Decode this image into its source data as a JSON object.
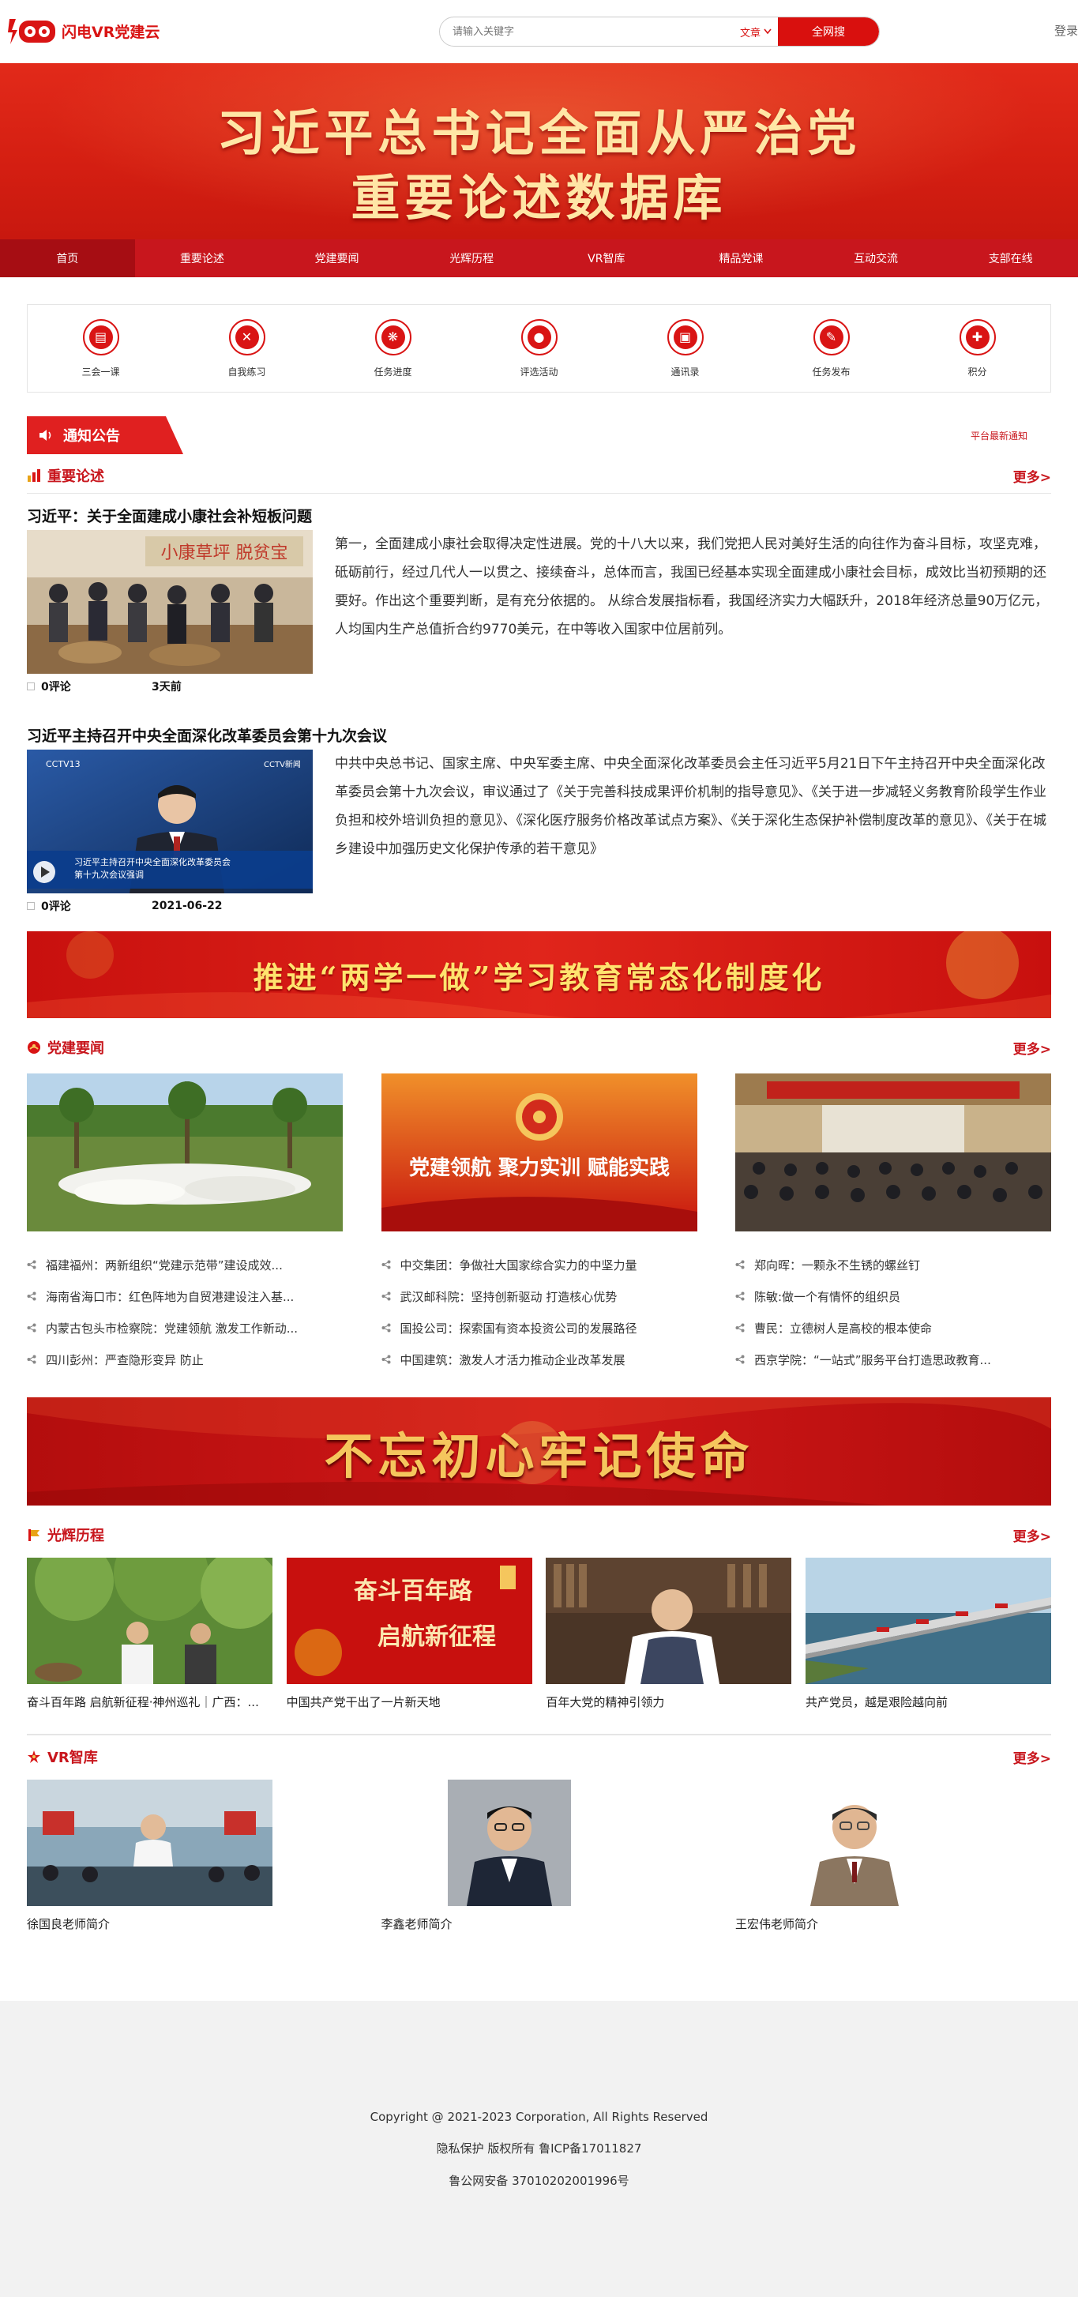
{
  "header": {
    "logo_text": "闪电VR党建云",
    "search_placeholder": "请输入关键字",
    "search_scope": "文章",
    "search_button": "全网搜",
    "login": "登录"
  },
  "banner": {
    "line1": "习近平总书记全面从严治党",
    "line2": "重要论述数据库"
  },
  "nav": [
    {
      "label": "首页",
      "active": true
    },
    {
      "label": "重要论述"
    },
    {
      "label": "党建要闻"
    },
    {
      "label": "光辉历程"
    },
    {
      "label": "VR智库"
    },
    {
      "label": "精品党课"
    },
    {
      "label": "互动交流"
    },
    {
      "label": "支部在线"
    }
  ],
  "quick": [
    {
      "label": "三会一课",
      "icon": "meeting-icon"
    },
    {
      "label": "自我练习",
      "icon": "tools-icon"
    },
    {
      "label": "任务进度",
      "icon": "group-icon"
    },
    {
      "label": "评选活动",
      "icon": "person-icon"
    },
    {
      "label": "通讯录",
      "icon": "contacts-icon"
    },
    {
      "label": "任务发布",
      "icon": "task-icon"
    },
    {
      "label": "积分",
      "icon": "points-icon"
    }
  ],
  "notice": {
    "title": "通知公告",
    "text": "平台最新通知"
  },
  "section_key": {
    "title": "重要论述",
    "more": "更多>"
  },
  "articles": [
    {
      "title": "习近平：关于全面建成小康社会补短板问题",
      "text": "第一，全面建成小康社会取得决定性进展。党的十八大以来，我们党把人民对美好生活的向往作为奋斗目标，攻坚克难，砥砺前行，经过几代人一以贯之、接续奋斗，总体而言，我国已经基本实现全面建成小康社会目标，成效比当初预期的还要好。作出这个重要判断，是有充分依据的。 从综合发展指标看，我国经济实力大幅跃升，2018年经济总量90万亿元，人均国内生产总值折合约9770美元，在中等收入国家中位居前列。",
      "comments": "0评论",
      "time": "3天前"
    },
    {
      "title": "习近平主持召开中央全面深化改革委员会第十九次会议",
      "text": "中共中央总书记、国家主席、中央军委主席、中央全面深化改革委员会主任习近平5月21日下午主持召开中央全面深化改革委员会第十九次会议，审议通过了《关于完善科技成果评价机制的指导意见》、《关于进一步减轻义务教育阶段学生作业负担和校外培训负担的意见》、《深化医疗服务价格改革试点方案》、《关于深化生态保护补偿制度改革的意见》、《关于在城乡建设中加强历史文化保护传承的若干意见》",
      "comments": "0评论",
      "time": "2021-06-22",
      "img_caption1": "习近平主持召开中央全面深化改革委员会",
      "img_caption2": "第十九次会议强调"
    }
  ],
  "ad1": "推进“两学一做”学习教育常态化制度化",
  "section_news": {
    "title": "党建要闻",
    "more": "更多>"
  },
  "news_cols": [
    {
      "items": [
        "福建福州：两新组织“党建示范带”建设成效...",
        "海南省海口市：红色阵地为自贸港建设注入基...",
        "内蒙古包头市检察院：党建领航 激发工作新动...",
        "四川彭州：严查隐形变异 防止"
      ]
    },
    {
      "img_text": "党建领航 聚力实训 赋能实践",
      "items": [
        "中交集团：争做社大国家综合实力的中坚力量",
        "武汉邮科院：坚持创新驱动 打造核心优势",
        "国投公司：探索国有资本投资公司的发展路径",
        "中国建筑：激发人才活力推动企业改革发展"
      ]
    },
    {
      "items": [
        "郑向晖：一颗永不生锈的螺丝钉",
        "陈敏:做一个有情怀的组织员",
        "曹民：立德树人是高校的根本使命",
        "西京学院：“一站式”服务平台打造思政教育..."
      ]
    }
  ],
  "ad2": "不忘初心牢记使命",
  "section_history": {
    "title": "光辉历程",
    "more": "更多>"
  },
  "history": [
    {
      "caption": "奋斗百年路 启航新征程·神州巡礼｜广西：..."
    },
    {
      "caption": "中国共产党干出了一片新天地",
      "img_text1": "奋斗百年路",
      "img_text2": "启航新征程"
    },
    {
      "caption": "百年大党的精神引领力"
    },
    {
      "caption": "共产党员，越是艰险越向前"
    }
  ],
  "section_vr": {
    "title": "VR智库",
    "more": "更多>"
  },
  "vr": [
    {
      "caption": "徐国良老师简介"
    },
    {
      "caption": "李鑫老师简介"
    },
    {
      "caption": "王宏伟老师简介"
    }
  ],
  "footer": {
    "line1": "Copyright @ 2021-2023 Corporation, All Rights Reserved",
    "line2": "隐私保护 版权所有 鲁ICP备17011827",
    "line3": "鲁公网安备 37010202001996号"
  },
  "colors": {
    "brand": "#d91414",
    "nav": "#c8161d",
    "nav_active": "#a60d13"
  }
}
